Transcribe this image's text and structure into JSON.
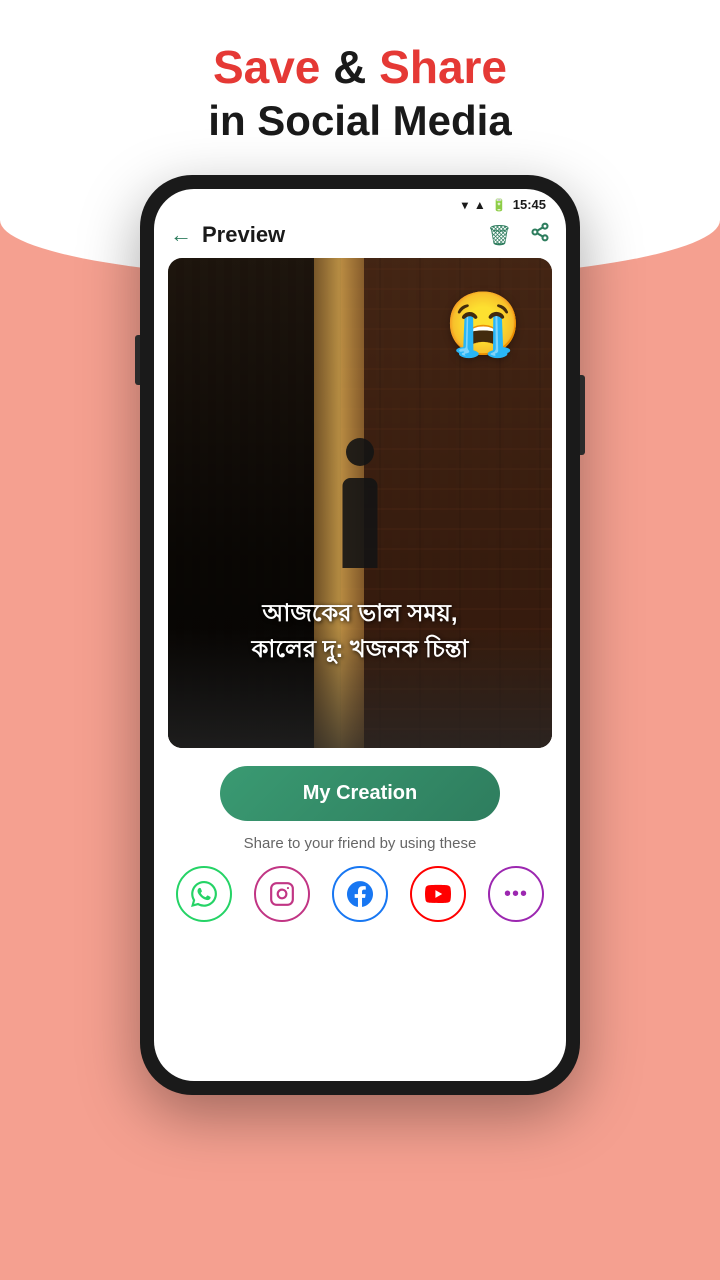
{
  "header": {
    "title_save": "Save",
    "title_ampersand": "&",
    "title_share": "Share",
    "subtitle": "in Social Media"
  },
  "status_bar": {
    "time": "15:45"
  },
  "app_bar": {
    "title": "Preview"
  },
  "image": {
    "bengali_text_line1": "আজকের ভাল সময়,",
    "bengali_text_line2": "কালের দু: খজনক চিন্তা",
    "emoji": "😭"
  },
  "buttons": {
    "my_creation": "My Creation"
  },
  "share_section": {
    "label": "Share to your friend by using these"
  },
  "social": {
    "whatsapp_label": "WhatsApp",
    "instagram_label": "Instagram",
    "facebook_label": "Facebook",
    "youtube_label": "YouTube",
    "more_label": "More"
  }
}
